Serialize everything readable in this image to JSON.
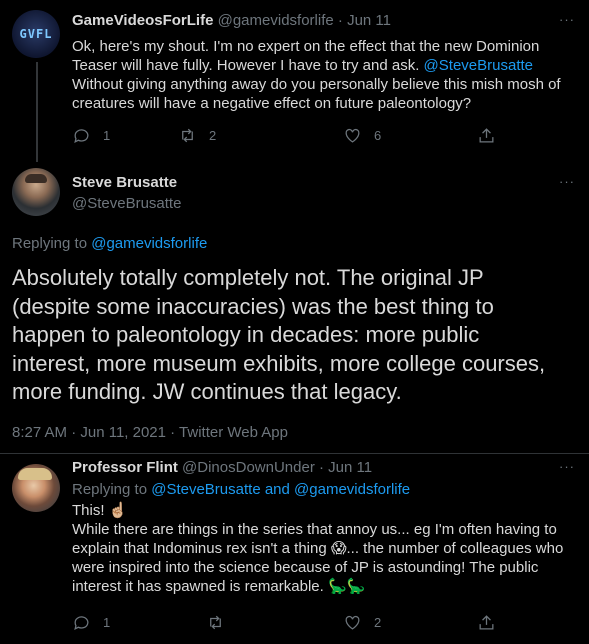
{
  "tweet1": {
    "avatar_text": "GVFL",
    "name": "GameVideosForLife",
    "handle": "@gamevidsforlife",
    "sep": "·",
    "date": "Jun 11",
    "more": "···",
    "text_a": "Ok, here's my shout. I'm no expert on the effect that the new Dominion Teaser will have fully. However I have to try and ask. ",
    "mention": "@SteveBrusatte",
    "text_b": "Without giving anything away do you personally believe this mish mosh of creatures will have a negative effect on future paleontology?",
    "replies": "1",
    "retweets": "2",
    "likes": "6"
  },
  "main": {
    "name": "Steve Brusatte",
    "handle": "@SteveBrusatte",
    "more": "···",
    "replying_prefix": "Replying to ",
    "replying_to": "@gamevidsforlife",
    "text": "Absolutely totally completely not. The original JP (despite some inaccuracies) was the best thing to happen to paleontology in decades: more public interest, more museum exhibits, more college courses, more funding. JW continues that legacy.",
    "meta": "8:27 AM · Jun 11, 2021 · Twitter Web App"
  },
  "reply": {
    "name": "Professor Flint",
    "handle": "@DinosDownUnder",
    "sep": "·",
    "date": "Jun 11",
    "more": "···",
    "replying_prefix": "Replying to ",
    "replying_a": "@SteveBrusatte",
    "replying_and": " and ",
    "replying_b": "@gamevidsforlife",
    "line1": "This! ",
    "emoji1": "☝🏼",
    "line2a": "While there are things in the series that annoy us... eg I'm often having to explain that Indominus rex isn't a thing ",
    "emoji2": "😱",
    "line2b": "... the number of colleagues who were inspired into the science because of JP is astounding! The public interest it has spawned is remarkable. ",
    "emoji3": "🦕🦕",
    "replies": "1",
    "retweets": "",
    "likes": "2"
  },
  "colors": {
    "background": "#000000",
    "text": "#d9d9d9",
    "muted": "#6e767d",
    "link": "#1d9bf0"
  }
}
